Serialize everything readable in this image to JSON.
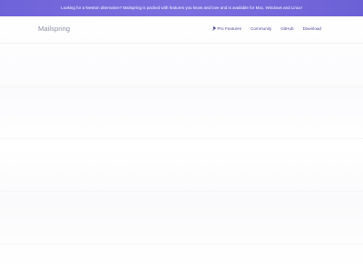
{
  "banner": {
    "text": "Looking for a Newton alternative? Mailspring is packed with features you know and love and is available for Mac, Windows and Linux!"
  },
  "header": {
    "brand": "Mailspring",
    "nav": [
      {
        "label": "Pro Features",
        "icon": "pin-icon"
      },
      {
        "label": "Community"
      },
      {
        "label": "GitHub"
      },
      {
        "label": "Download"
      }
    ]
  },
  "colors": {
    "banner_bg": "#7066dc",
    "nav_link": "#4f4a9a",
    "brand": "#8a8fa3"
  }
}
